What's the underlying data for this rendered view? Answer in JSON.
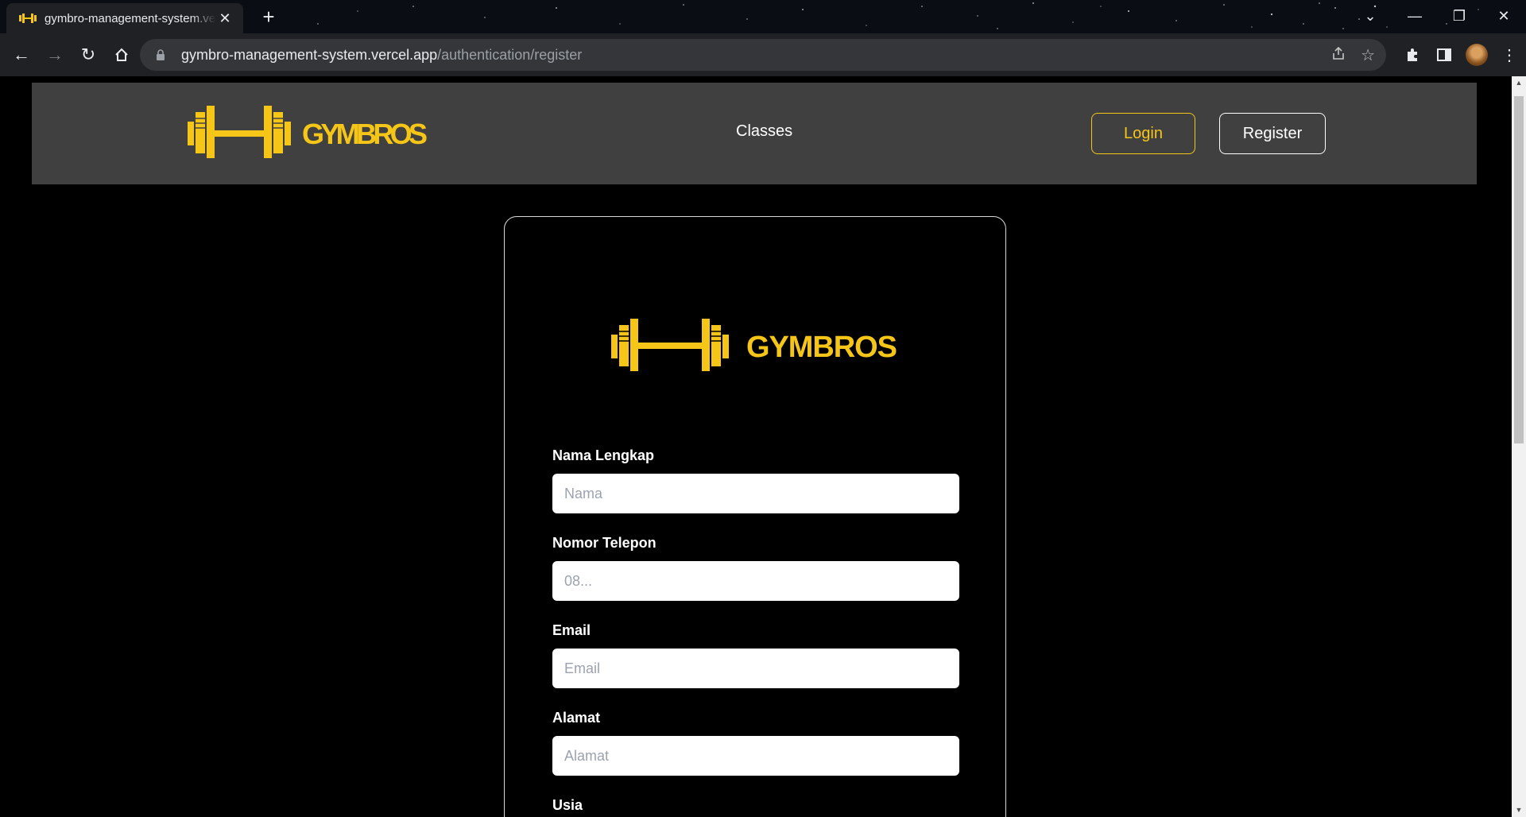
{
  "browser": {
    "tab_title": "gymbro-management-system.vercel.app",
    "url_host": "gymbro-management-system.vercel.app",
    "url_path": "/authentication/register"
  },
  "navbar": {
    "logo_text": "GYMBROS",
    "classes_label": "Classes",
    "login_label": "Login",
    "register_label": "Register"
  },
  "form": {
    "logo_text": "GYMBROS",
    "fields": [
      {
        "label": "Nama Lengkap",
        "placeholder": "Nama"
      },
      {
        "label": "Nomor Telepon",
        "placeholder": "08..."
      },
      {
        "label": "Email",
        "placeholder": "Email"
      },
      {
        "label": "Alamat",
        "placeholder": "Alamat"
      },
      {
        "label": "Usia",
        "placeholder": ""
      }
    ]
  },
  "colors": {
    "brand_yellow": "#f5c518",
    "navbar_bg": "#404040",
    "page_bg": "#000000"
  }
}
